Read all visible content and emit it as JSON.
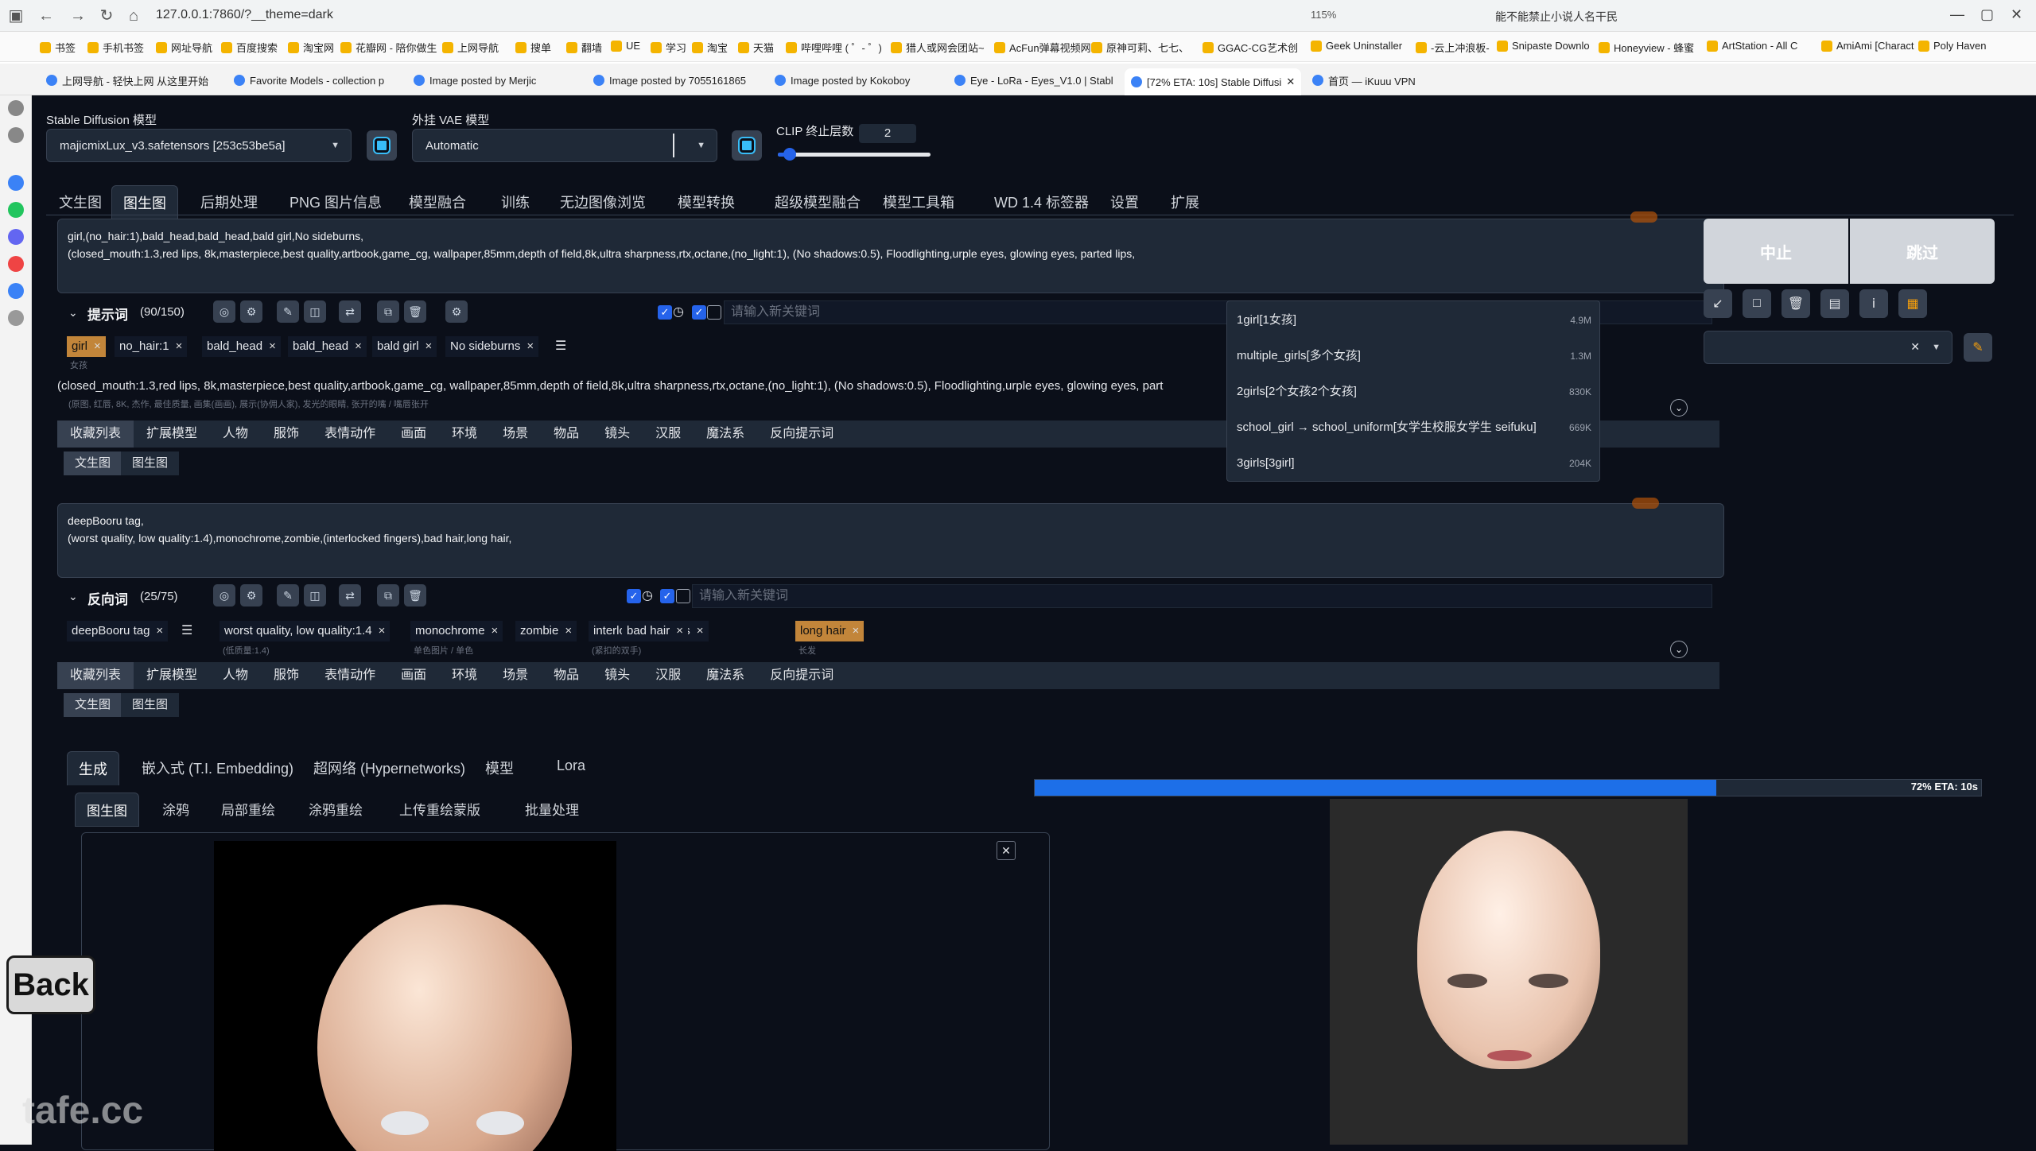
{
  "browser": {
    "url": "127.0.0.1:7860/?__theme=dark",
    "zoom": "115%",
    "ext_text": "能不能禁止小说人名干民",
    "bookmarks": [
      "书签",
      "手机书签",
      "网址导航",
      "百度搜索",
      "淘宝网",
      "花瓣网 - 陪你做生",
      "上网导航",
      "搜单",
      "翻墙",
      "UE",
      "学习",
      "淘宝",
      "天猫",
      "哔哩哔哩 ( ゜- ゜)",
      "猎人或网会团站~",
      "AcFun弹幕视频网",
      "原神可莉、七七、",
      "GGAC-CG艺术创",
      "Geek Uninstaller",
      "-云上冲浪板-",
      "Snipaste Downlo",
      "Honeyview - 蜂蜜",
      "ArtStation - All C",
      "AmiAmi [Charact",
      "Poly Haven"
    ],
    "tabs": [
      "上网导航 - 轻快上网 从这里开始",
      "Favorite Models - collection p",
      "Image posted by Merjic",
      "Image posted by 7055161865",
      "Image posted by Kokoboy",
      "Eye - LoRa - Eyes_V1.0 | Stabl",
      "[72% ETA: 10s] Stable Diffusi",
      "首页 — iKuuu VPN"
    ]
  },
  "top": {
    "sd_model_label": "Stable Diffusion 模型",
    "sd_model_value": "majicmixLux_v3.safetensors [253c53be5a]",
    "vae_label": "外挂 VAE 模型",
    "vae_value": "Automatic",
    "clip_label": "CLIP 终止层数",
    "clip_value": "2",
    "clip_fraction": 0.08
  },
  "main_tabs": [
    "文生图",
    "图生图",
    "后期处理",
    "PNG 图片信息",
    "模型融合",
    "训练",
    "无边图像浏览",
    "模型转换",
    "超级模型融合",
    "模型工具箱",
    "WD 1.4 标签器",
    "设置",
    "扩展"
  ],
  "prompt": {
    "text": "girl,(no_hair:1),bald_head,bald_head,bald girl,No sideburns,\n(closed_mouth:1.3,red lips, 8k,masterpiece,best quality,artbook,game_cg, wallpaper,85mm,depth of field,8k,ultra sharpness,rtx,octane,(no_light:1), (No shadows:0.5), Floodlighting,urple eyes, glowing eyes, parted lips,",
    "title": "提示词",
    "count": "(90/150)",
    "keyword_placeholder": "请输入新关键词",
    "chips": [
      {
        "label": "girl",
        "sub": "女孩",
        "hl": true
      },
      {
        "label": "no_hair:1",
        "sub": "",
        "hl": false
      },
      {
        "label": "bald_head",
        "sub": "",
        "hl": false
      },
      {
        "label": "bald_head",
        "sub": "",
        "hl": false
      },
      {
        "label": "bald girl",
        "sub": "",
        "hl": false
      },
      {
        "label": "No sideburns",
        "sub": "",
        "hl": false
      }
    ],
    "line2": "(closed_mouth:1.3,red lips, 8k,masterpiece,best quality,artbook,game_cg, wallpaper,85mm,depth of field,8k,ultra sharpness,rtx,octane,(no_light:1), (No shadows:0.5), Floodlighting,urple eyes, glowing eyes, part",
    "line2_sub": "(原图, 红唇, 8K, 杰作, 最佳质量, 画集(画画), 展示(协佣人家), 发光的眼睛, 张开的嘴 / 嘴唇张开"
  },
  "categories": [
    "收藏列表",
    "扩展模型",
    "人物",
    "服饰",
    "表情动作",
    "画面",
    "环境",
    "场景",
    "物品",
    "镜头",
    "汉服",
    "魔法系",
    "反向提示词"
  ],
  "sub_tabs": [
    "文生图",
    "图生图"
  ],
  "autocomplete": [
    {
      "label": "1girl[1女孩]",
      "count": "4.9M"
    },
    {
      "label": "multiple_girls[多个女孩]",
      "count": "1.3M"
    },
    {
      "label": "2girls[2个女孩2个女孩]",
      "count": "830K"
    },
    {
      "label": "school_girl → school_uniform[女学生校服女学生 seifuku]",
      "count": "669K"
    },
    {
      "label": "3girls[3girl]",
      "count": "204K"
    }
  ],
  "negative": {
    "text": "deepBooru tag,\n(worst quality, low quality:1.4),monochrome,zombie,(interlocked fingers),bad hair,long hair,",
    "title": "反向词",
    "count": "(25/75)",
    "keyword_placeholder": "请输入新关键词",
    "chips": [
      {
        "label": "deepBooru tag",
        "sub": "",
        "hl": false
      },
      {
        "label": "worst quality, low quality:1.4",
        "sub": "(低质量:1.4)",
        "hl": false
      },
      {
        "label": "monochrome",
        "sub": "单色图片 / 单色",
        "hl": false
      },
      {
        "label": "zombie",
        "sub": "",
        "hl": false
      },
      {
        "label": "interlocked fingers",
        "sub": "(紧扣的双手)",
        "hl": false
      },
      {
        "label": "bad hair",
        "sub": "",
        "hl": false
      },
      {
        "label": "long hair",
        "sub": "长发",
        "hl": true
      }
    ]
  },
  "right": {
    "interrupt": "中止",
    "skip": "跳过"
  },
  "gen_tabs": [
    "生成",
    "嵌入式 (T.I. Embedding)",
    "超网络 (Hypernetworks)",
    "模型",
    "Lora"
  ],
  "img_tabs": [
    "图生图",
    "涂鸦",
    "局部重绘",
    "涂鸦重绘",
    "上传重绘蒙版",
    "批量处理"
  ],
  "progress": {
    "label": "72% ETA: 10s",
    "fraction": 0.72
  },
  "overlay": {
    "back": "Back",
    "watermark": "tafe.cc"
  },
  "colors": {
    "accent": "#1d6fe8",
    "highlight_chip": "#c2853a",
    "bg": "#0b0f19"
  }
}
